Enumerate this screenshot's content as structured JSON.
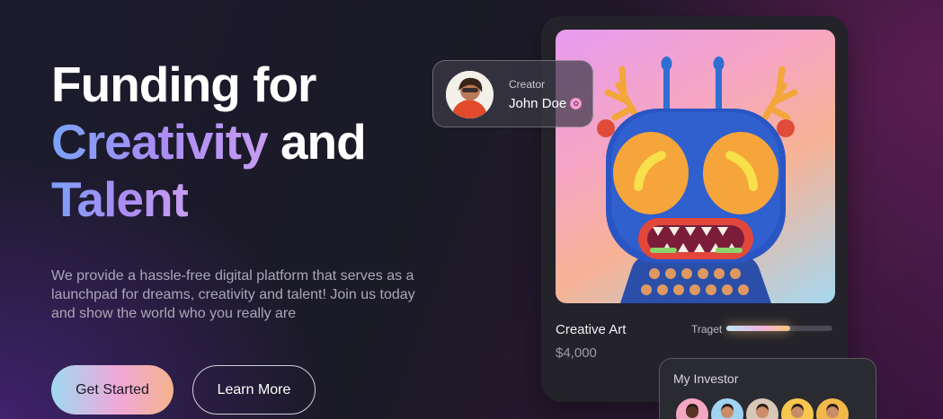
{
  "hero": {
    "title_line1": "Funding for",
    "title_grad1": "Creativity",
    "title_and": " and",
    "title_grad2": "Talent",
    "description": "We provide a hassle-free digital platform that serves as a launchpad for dreams, creativity and talent! Join us today and show the world who you really are"
  },
  "buttons": {
    "primary_label": "Get Started",
    "secondary_label": "Learn More"
  },
  "creator": {
    "label": "Creator",
    "name": "John Doe",
    "verified_icon": "verified-badge-icon"
  },
  "artwork": {
    "name": "Creative Art",
    "price": "$4,000",
    "target_label": "Traget",
    "target_progress": 0.6
  },
  "investors": {
    "title": "My Investor",
    "avatar_colors": [
      "#f4a7c3",
      "#9fd3f0",
      "#d8c7b6",
      "#f6c64d",
      "#f2b84a"
    ]
  },
  "colors": {
    "accent_gradient_start": "#7aa2f7",
    "accent_gradient_end": "#c79df2",
    "card_bg": "#232329"
  }
}
